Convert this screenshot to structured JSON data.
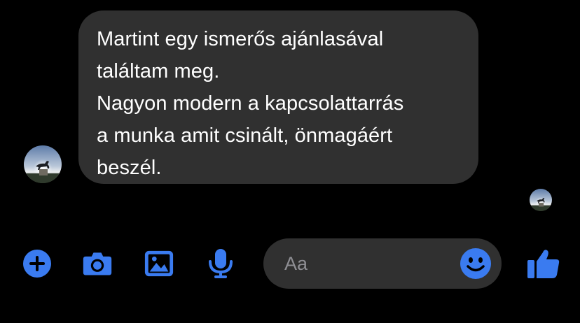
{
  "message": {
    "lines": [
      "Martint egy ismerős ajánlasával",
      "találtam meg.",
      "Nagyon modern a kapcsolattarrás",
      "a munka amit csinált, önmagáért",
      "beszél."
    ]
  },
  "composer": {
    "placeholder": "Aa"
  },
  "icons": {
    "add": "plus-circle-icon",
    "camera": "camera-icon",
    "gallery": "image-icon",
    "voice": "microphone-icon",
    "emoji": "smiley-icon",
    "like": "thumbs-up-icon"
  },
  "colors": {
    "background": "#000000",
    "bubble": "#303030",
    "accent": "#3a7bf0",
    "text": "#ffffff",
    "placeholder": "#8e8e93"
  }
}
